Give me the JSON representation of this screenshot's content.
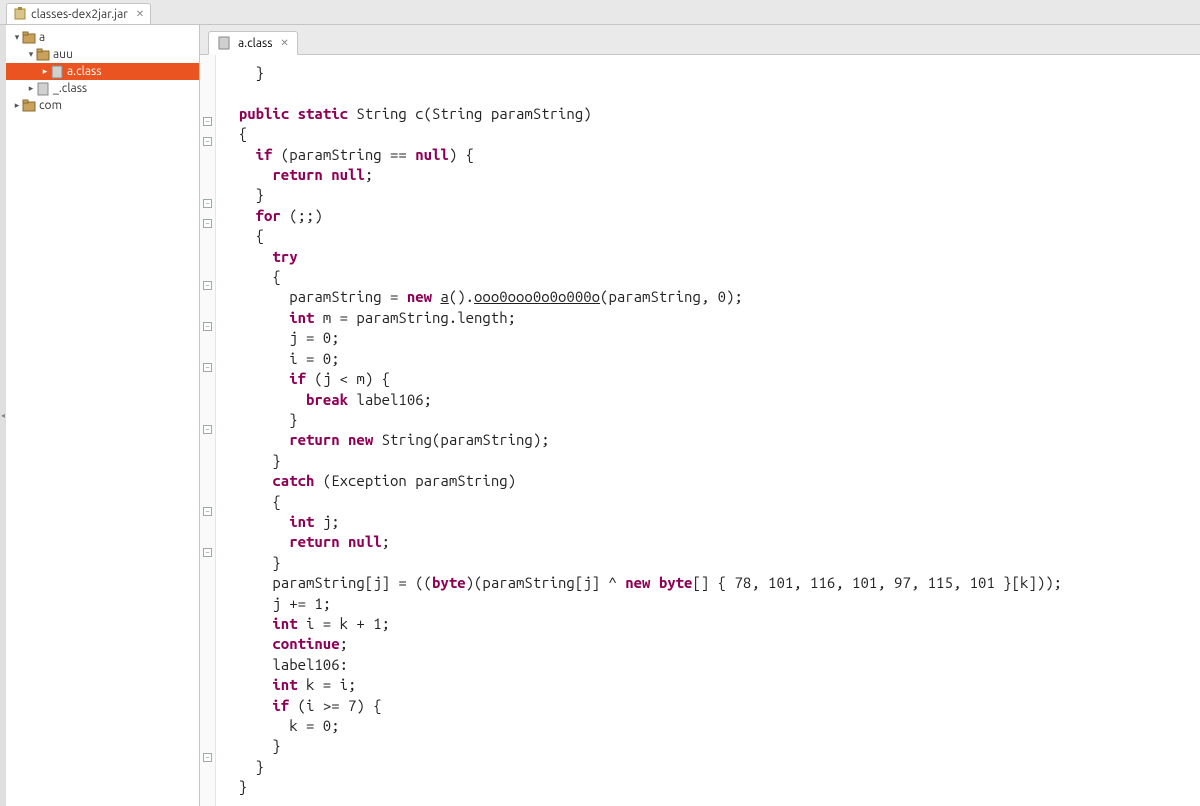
{
  "topTab": {
    "label": "classes-dex2jar.jar"
  },
  "tree": {
    "n0": {
      "exp": "▾",
      "label": "a",
      "indent": 0,
      "icon": "pkg"
    },
    "n1": {
      "exp": "▾",
      "label": "auu",
      "indent": 14,
      "icon": "pkg"
    },
    "n2": {
      "exp": "▸",
      "label": "a.class",
      "indent": 28,
      "icon": "class",
      "selected": true
    },
    "n3": {
      "exp": "▸",
      "label": "_.class",
      "indent": 14,
      "icon": "class"
    },
    "n4": {
      "exp": "▸",
      "label": "com",
      "indent": 0,
      "icon": "pkg"
    }
  },
  "editorTab": {
    "label": "a.class"
  },
  "folds": [
    62,
    82,
    144,
    164,
    226,
    267,
    308,
    370,
    452,
    493,
    698
  ],
  "code": {
    "l1": "    }",
    "l2": "  ",
    "l3a": "  ",
    "l3b": "public",
    "l3c": " ",
    "l3d": "static",
    "l3e": " String c(String paramString)",
    "l4": "  {",
    "l5a": "    ",
    "l5b": "if",
    "l5c": " (paramString == ",
    "l5d": "null",
    "l5e": ") {",
    "l6a": "      ",
    "l6b": "return",
    "l6c": " ",
    "l6d": "null",
    "l6e": ";",
    "l7": "    }",
    "l8a": "    ",
    "l8b": "for",
    "l8c": " (;;)",
    "l9": "    {",
    "l10a": "      ",
    "l10b": "try",
    "l11": "      {",
    "l12a": "        paramString = ",
    "l12b": "new",
    "l12c": " ",
    "l12d": "a",
    "l12e": "().",
    "l12f": "ooo0ooo0o0o000o",
    "l12g": "(paramString, 0);",
    "l13a": "        ",
    "l13b": "int",
    "l13c": " m = paramString.length;",
    "l14": "        j = 0;",
    "l15": "        i = 0;",
    "l16a": "        ",
    "l16b": "if",
    "l16c": " (j < m) {",
    "l17a": "          ",
    "l17b": "break",
    "l17c": " label106;",
    "l18": "        }",
    "l19a": "        ",
    "l19b": "return",
    "l19c": " ",
    "l19d": "new",
    "l19e": " String(paramString);",
    "l20": "      }",
    "l21a": "      ",
    "l21b": "catch",
    "l21c": " (Exception paramString)",
    "l22": "      {",
    "l23a": "        ",
    "l23b": "int",
    "l23c": " j;",
    "l24a": "        ",
    "l24b": "return",
    "l24c": " ",
    "l24d": "null",
    "l24e": ";",
    "l25": "      }",
    "l26a": "      paramString[j] = ((",
    "l26b": "byte",
    "l26c": ")(paramString[j] ^ ",
    "l26d": "new",
    "l26e": " ",
    "l26f": "byte",
    "l26g": "[] { 78, 101, 116, 101, 97, 115, 101 }[k]));",
    "l27": "      j += 1;",
    "l28a": "      ",
    "l28b": "int",
    "l28c": " i = k + 1;",
    "l29a": "      ",
    "l29b": "continue",
    "l29c": ";",
    "l30": "      label106:",
    "l31a": "      ",
    "l31b": "int",
    "l31c": " k = i;",
    "l32a": "      ",
    "l32b": "if",
    "l32c": " (i >= 7) {",
    "l33": "        k = 0;",
    "l34": "      }",
    "l35": "    }",
    "l36": "  }"
  }
}
